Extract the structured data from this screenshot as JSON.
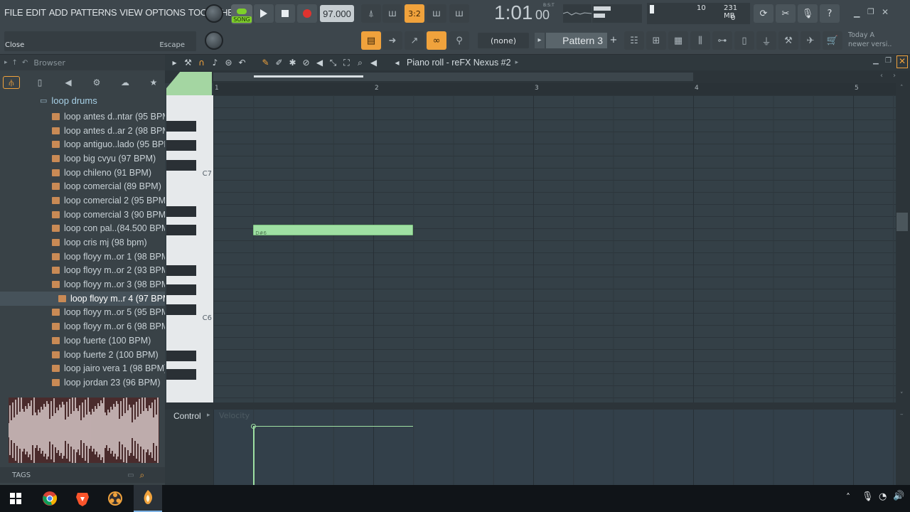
{
  "menu": [
    "FILE",
    "EDIT",
    "ADD",
    "PATTERNS",
    "VIEW",
    "OPTIONS",
    "TOOLS",
    "HELP"
  ],
  "transport": {
    "song_label": "SONG",
    "tempo": "97.000",
    "time": "1:01",
    "time_ticks": "00",
    "time_unit": "B:S:T"
  },
  "monitor": {
    "cpu": "10",
    "mem": "231 MB",
    "voices": "0"
  },
  "hint": {
    "left_text": "Close",
    "right_text": "Escape"
  },
  "snap": "(none)",
  "pattern": "Pattern 3",
  "news": {
    "title": "Today A",
    "sub": "newer versi.."
  },
  "browser": {
    "title": "Browser",
    "folder": "loop drums",
    "items": [
      "loop antes d..ntar (95 BPM)",
      "loop antes d..ar 2 (98 BPM)",
      "loop antiguo..lado (95 BPM)",
      "loop big cvyu (97 BPM)",
      "loop chileno (91 BPM)",
      "loop comercial (89 BPM)",
      "loop comercial 2 (95 BPM)",
      "loop comercial 3 (90 BPM)",
      "loop con pal..(84.500 BPM)",
      "loop cris mj (98 bpm)",
      "loop floyy m..or 1 (98 BPM)",
      "loop floyy m..or 2 (93 BPM)",
      "loop floyy m..or 3 (98 BPM)",
      "loop floyy m..r 4 (97 BPM)",
      "loop floyy m..or 5 (95 BPM)",
      "loop floyy m..or 6 (98 BPM)",
      "loop fuerte (100 BPM)",
      "loop fuerte 2 (100 BPM)",
      "loop jairo vera 1 (98 BPM)",
      "loop jordan 23 (96 BPM)"
    ],
    "selected_index": 13,
    "tags_label": "TAGS"
  },
  "piano_roll": {
    "title": "Piano roll - reFX Nexus #2",
    "bars": [
      "1",
      "2",
      "3",
      "4",
      "5"
    ],
    "keys": [
      "C7",
      "C6"
    ],
    "note": {
      "label": "D#6",
      "start_bar": 1.25,
      "length_bars": 1.0
    },
    "control_label": "Control",
    "control_param": "Velocity"
  },
  "colors": {
    "accent": "#f0a23c",
    "note": "#9fe0a3",
    "song_green": "#7ed02a",
    "record": "#e0332f"
  }
}
